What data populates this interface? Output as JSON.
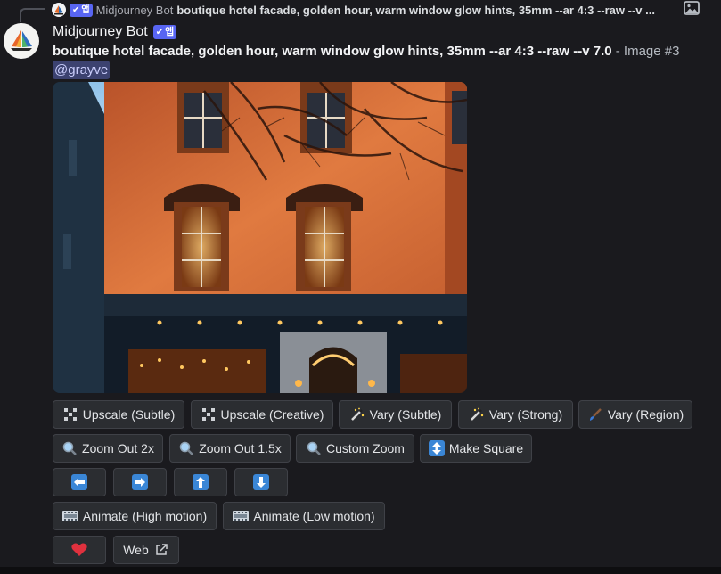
{
  "reply": {
    "author": "Midjourney Bot",
    "badge": "앱",
    "text": "boutique hotel facade, golden hour, warm window glow hints, 35mm --ar 4:3 --raw --v ..."
  },
  "message": {
    "author": "Midjourney Bot",
    "badge": "앱",
    "prompt": "boutique hotel facade, golden hour, warm window glow hints, 35mm --ar 4:3 --raw --v 7.0",
    "suffix": " - Image #3",
    "mention": "@grayve"
  },
  "buttons": {
    "upscale_subtle": "Upscale (Subtle)",
    "upscale_creative": "Upscale (Creative)",
    "vary_subtle": "Vary (Subtle)",
    "vary_strong": "Vary (Strong)",
    "vary_region": "Vary (Region)",
    "zoom_out_2x": "Zoom Out 2x",
    "zoom_out_1_5x": "Zoom Out 1.5x",
    "custom_zoom": "Custom Zoom",
    "make_square": "Make Square",
    "animate_high": "Animate (High motion)",
    "animate_low": "Animate (Low motion)",
    "web": "Web"
  },
  "colors": {
    "background": "#1a1a1e",
    "button_bg": "#2b2d31",
    "badge": "#5865f2",
    "mention_bg": "#3c4270",
    "arrow_blue": "#3a86d6",
    "heart": "#e0313e"
  }
}
